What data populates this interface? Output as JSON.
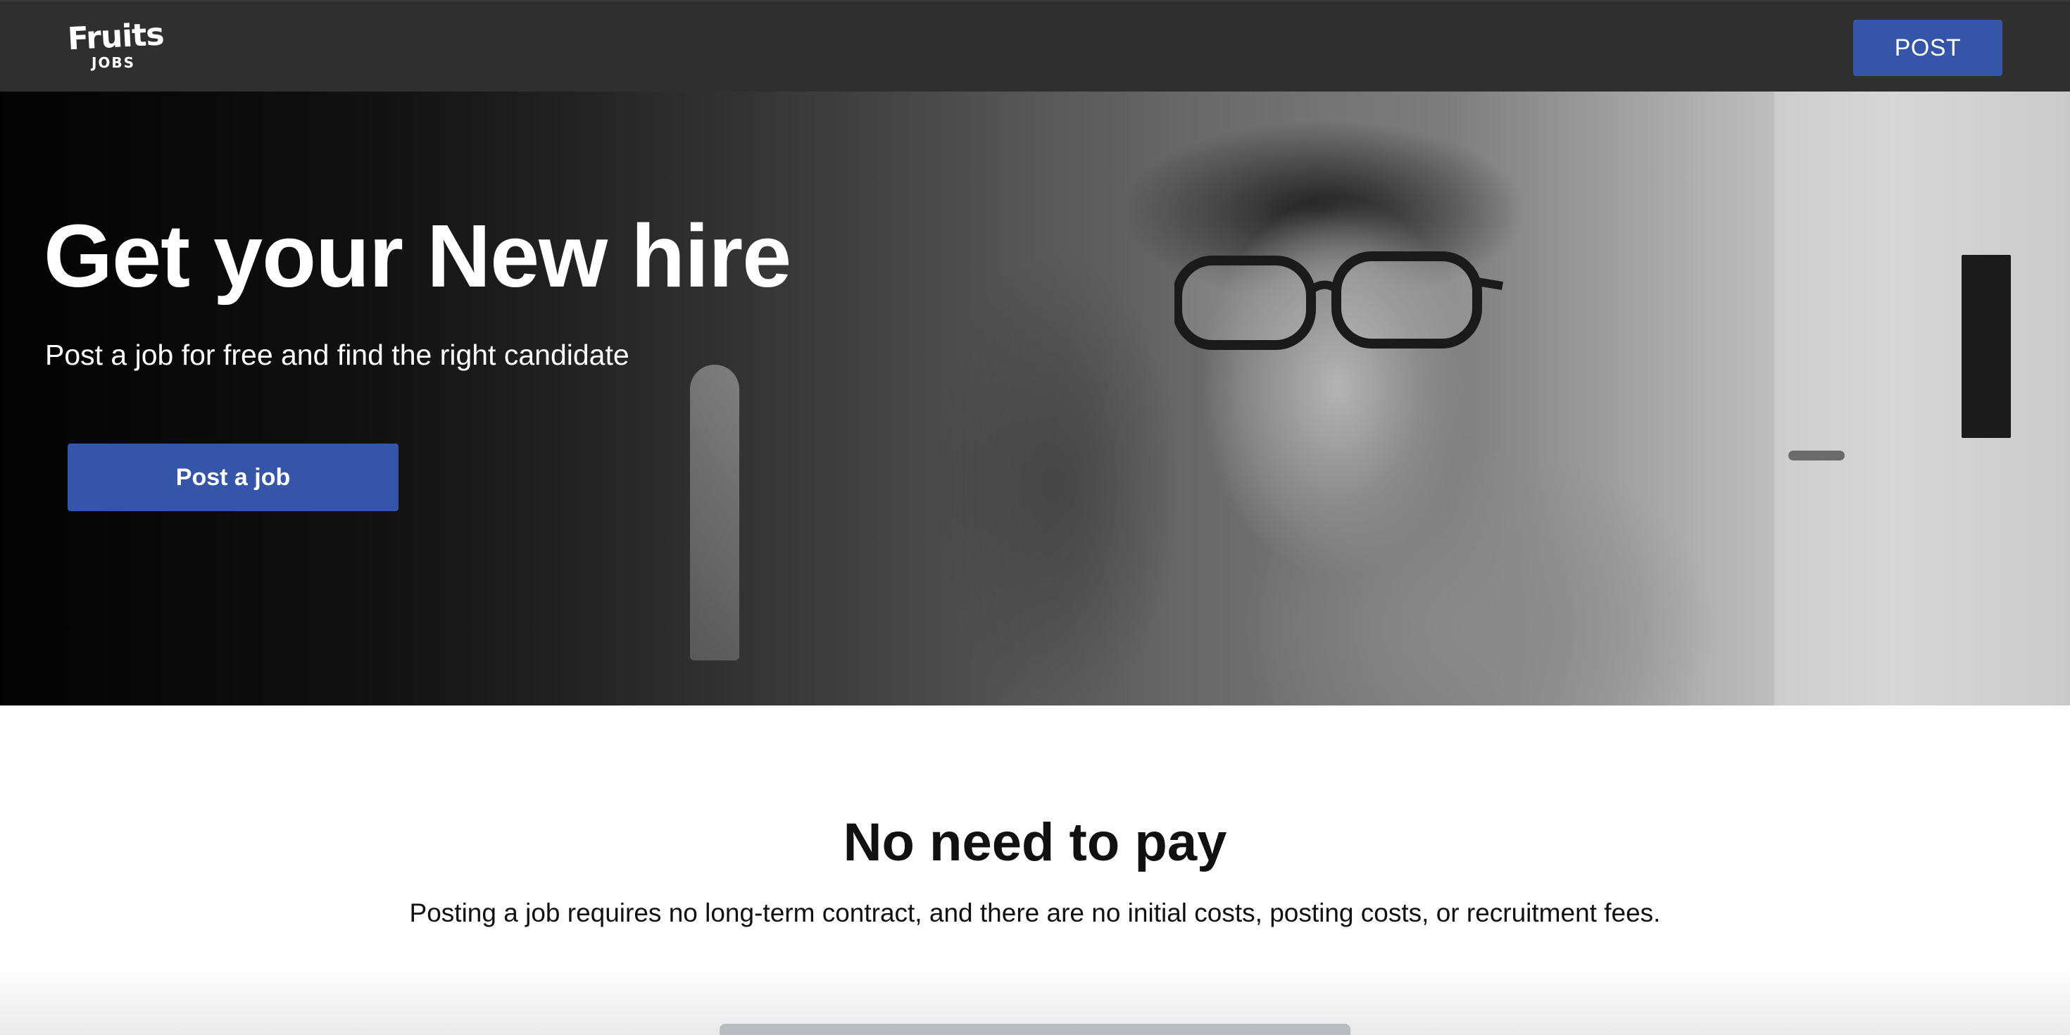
{
  "header": {
    "logo": {
      "main": "Fruits",
      "sub": "JOBS"
    },
    "post_button_label": "POST"
  },
  "hero": {
    "title": "Get your New hire",
    "subtitle": "Post a job for free and find the right candidate",
    "cta_label": "Post a job"
  },
  "info": {
    "title": "No need to pay",
    "description": "Posting a job requires no long-term contract, and there are no initial costs, posting costs, or recruitment fees."
  },
  "colors": {
    "header_background": "#2f2f2f",
    "accent_button": "#3555a8",
    "text_light": "#ffffff",
    "text_dark": "#111111"
  }
}
